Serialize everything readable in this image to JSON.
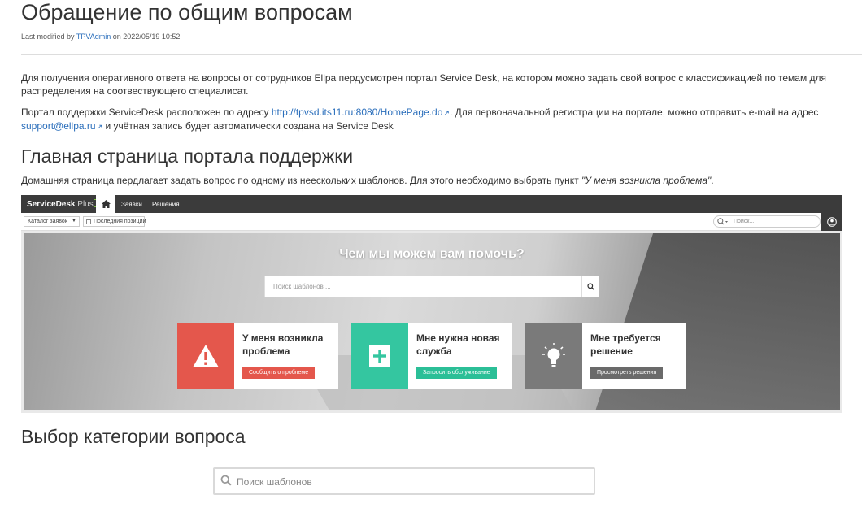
{
  "page": {
    "title": "Обращение по общим вопросам",
    "meta_prefix": "Last modified by",
    "meta_author": "TPVAdmin",
    "meta_on": "on",
    "meta_date": "2022/05/19 10:52"
  },
  "content": {
    "p1": "Для получения оперативного ответа на вопросы от сотрудников Ellpa пердусмотрен портал Service Desk, на котором можно задать свой вопрос с классификацией по темам для распределения на соотвествующего специалисат.",
    "p2_start": "Портал поддержки ServiceDesk расположен по адресу ",
    "p2_link": "http://tpvsd.its11.ru:8080/HomePage.do",
    "p2_mid": ". Для первоначальной регистрации на портале, можно отправить e-mail на адрес ",
    "p2_email": "support@ellpa.ru",
    "p2_end": " и учётная запись будет автоматически создана на Service Desk",
    "h2_portal": "Главная страница портала поддержки",
    "p3_start": "Домашняя страница пердлагает задать вопрос по одному из нееcкольких шаблонов. Для этого необходимо выбрать пункт ",
    "p3_quote": "\"У меня возникла проблема\"",
    "p3_end": ".",
    "h2_category": "Выбор категории вопроса",
    "search_placeholder": "Поиск шаблонов"
  },
  "servicedesk": {
    "logo": "ServiceDesk",
    "logo_plus": "Plus",
    "nav": [
      "Заявки",
      "Решения"
    ],
    "catalog": "Каталог заявок",
    "recent": "Последния позиции",
    "search_placeholder": "Поиск...",
    "hero_title": "Чем мы можем вам помочь?",
    "hero_search_placeholder": "Поиск шаблонов ...",
    "cards": [
      {
        "title": "У меня возникла проблема",
        "button": "Сообщить о проблеме"
      },
      {
        "title": "Мне нужна новая служба",
        "button": "Запросить обслуживание"
      },
      {
        "title": "Мне требуется решение",
        "button": "Просмотреть решения"
      }
    ]
  },
  "colors": {
    "link": "#2a6ebb",
    "problem": "#e4574c",
    "service": "#34c6a0",
    "solution": "#7a7a7a",
    "topbar": "#3b3b3b"
  },
  "icons": [
    "external-link-icon",
    "home-icon",
    "search-icon",
    "user-icon",
    "warning-icon",
    "plus-icon",
    "lightbulb-icon"
  ]
}
